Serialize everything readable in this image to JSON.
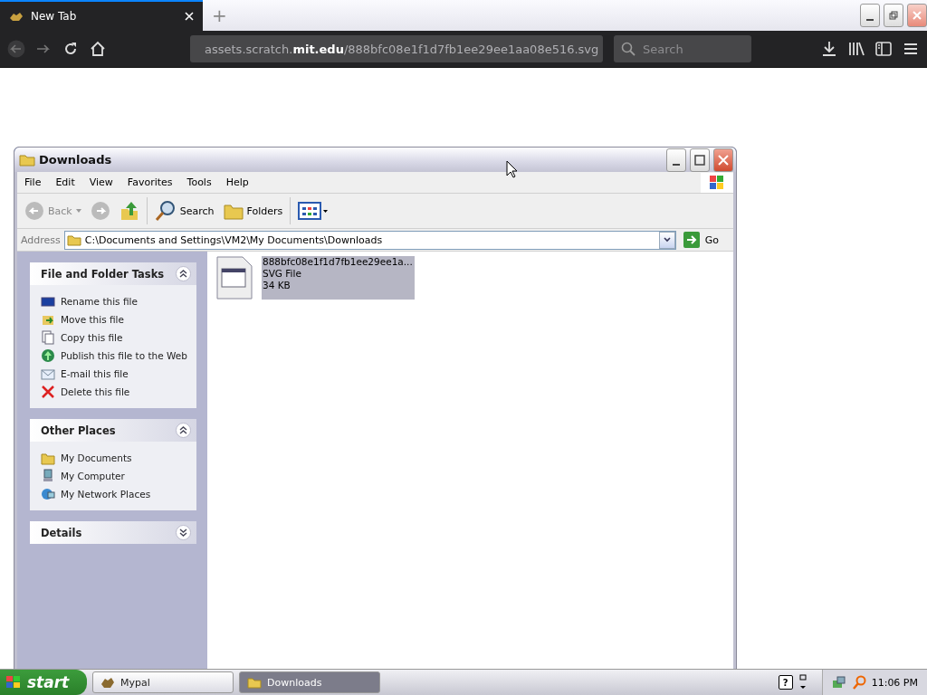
{
  "browser": {
    "tabs": [
      {
        "title": "New Tab",
        "selected": true
      }
    ],
    "new_tab": "+",
    "url": "assets.scratch.**mit.edu**/888bfc08e1f1d7fb1ee29ee1aa08e516.svg",
    "search": {
      "placeholder": "Search"
    }
  },
  "window": {
    "title": "Downloads",
    "menu": [
      "File",
      "Edit",
      "View",
      "Favorites",
      "Tools",
      "Help"
    ],
    "toolbar": [
      {
        "kind": "back",
        "label": "Back",
        "disabled": true
      },
      {
        "kind": "forward",
        "disabled": true
      },
      {
        "kind": "up"
      },
      {
        "kind": "search",
        "label": "Search"
      },
      {
        "kind": "folders",
        "label": "Folders"
      },
      {
        "kind": "views"
      }
    ],
    "address": {
      "label": "Address",
      "value": "C:\\Documents and Settings\\VM2\\My Documents\\Downloads",
      "go": "Go"
    },
    "panels": [
      {
        "title": "File and Folder Tasks",
        "expanded": true,
        "items": [
          {
            "kind": "rename",
            "label": "Rename this file"
          },
          {
            "kind": "move",
            "label": "Move this file"
          },
          {
            "kind": "copy",
            "label": "Copy this file"
          },
          {
            "kind": "publish",
            "label": "Publish this file to the Web"
          },
          {
            "kind": "email",
            "label": "E-mail this file"
          },
          {
            "kind": "delete",
            "label": "Delete this file"
          }
        ]
      },
      {
        "title": "Other Places",
        "expanded": true,
        "items": [
          {
            "kind": "documents",
            "label": "My Documents"
          },
          {
            "kind": "computer",
            "label": "My Computer"
          },
          {
            "kind": "network",
            "label": "My Network Places"
          }
        ]
      },
      {
        "title": "Details",
        "expanded": false
      }
    ],
    "files": [
      {
        "name": "888bfc08e1f1d7fb1ee29ee1a...",
        "type": "SVG File",
        "size": "34 KB",
        "selected": true
      }
    ]
  },
  "taskbar": {
    "start": "start",
    "buttons": [
      {
        "label": "Mypal",
        "selected": false
      },
      {
        "label": "Downloads",
        "selected": true
      }
    ],
    "help": "?",
    "clock": "11:06 PM"
  }
}
